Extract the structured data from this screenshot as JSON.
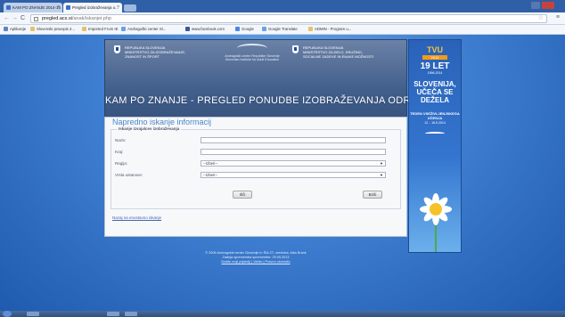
{
  "browser": {
    "tabs": [
      {
        "label": "KAM PO ZNANJE 2014-15"
      },
      {
        "label": "Pregled izobraževanja o..."
      }
    ],
    "url": {
      "host": "pregled.acs.si",
      "path": "/anak/iskanjei.php"
    },
    "bookmarks": [
      "Aplikacije",
      "Slovenski pravopis 2...",
      "Imported From IE",
      "Andragoški center Sl...",
      "www.facebook.com",
      "Google",
      "Google Translate",
      "ADMIN - Program u..."
    ]
  },
  "header": {
    "left_logo": "REPUBLIKA SLOVENIJA\nMINISTRSTVO ZA IZOBRAŽEVANJE,\nZNANOST IN ŠPORT",
    "center_logo": "Andragoški center Republike Slovenije",
    "center_logo_sub": "Slovenian Institute for Adult Education",
    "right_logo": "REPUBLIKA SLOVENIJA\nMINISTRSTVO ZA DELO, DRUŽINO,\nSOCIALNE ZADEVE IN ENAKE MOŽNOSTI",
    "title": "KAM PO ZNANJE - PREGLED PONUDBE IZOBRAŽEVANJA ODRASLIH"
  },
  "form": {
    "heading": "Napredno iskanje informacij",
    "legend": "Iskanje izvajalcev izobraževanja",
    "fields": {
      "naziv": {
        "label": "Naziv:",
        "value": ""
      },
      "kraj": {
        "label": "Kraj:",
        "value": ""
      },
      "regija": {
        "label": "Regija:",
        "selected": "--Izberi--"
      },
      "vrsta": {
        "label": "Vrsta ustanove:",
        "selected": "--Izberi--"
      }
    },
    "search_button": "Išči",
    "clear_button": "Briši",
    "simple_search_link": "Nazaj na enostavno iskanje"
  },
  "footer": {
    "line1": "© 2006 Andragoški center Slovenije in ŠIA ZT, uredniva: Aiša Brank",
    "line2": "Zadnja sprememba spremembe: 29.05.2013",
    "links": "Bodite moji prijatelji | Vabilo | Pravno obvestilo"
  },
  "promo": {
    "tvu": "TVU",
    "year": "2014",
    "let": "19 LET",
    "range": "1996-2014",
    "slogan": "SLOVENIJA, UČEČA SE DEŽELA",
    "teden": "TEDEN VSEŽIVLJENJSKEGA UČENJA",
    "dates": "12. - 16.5.2014"
  }
}
